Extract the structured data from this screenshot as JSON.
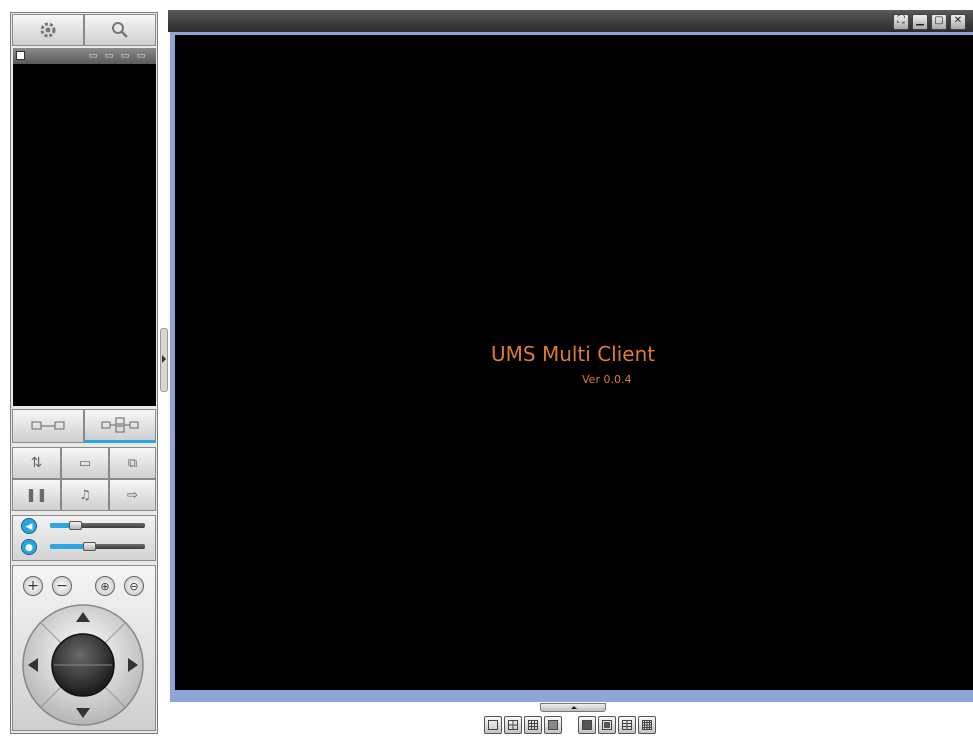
{
  "toolbar_top": {
    "settings_icon": "gear-icon",
    "search_icon": "magnifier-icon"
  },
  "device_panel": {
    "header_icons": [
      "add-device-icon",
      "edit-device-icon",
      "delete-device-icon",
      "refresh-device-icon"
    ]
  },
  "connection_tabs": [
    "single-connect-icon",
    "multi-connect-icon"
  ],
  "controls": {
    "row1": [
      "relay-icon",
      "edit-icon",
      "network-config-icon"
    ],
    "row2": [
      "pause-icon",
      "alarm-icon",
      "export-icon"
    ]
  },
  "sliders": {
    "volume": {
      "icon": "speaker-icon",
      "value": 0.27
    },
    "mic": {
      "icon": "microphone-icon",
      "value": 0.42
    }
  },
  "ptz": {
    "focus_plus": "+",
    "focus_minus": "−",
    "zoom_in_icon": "zoom-in-icon",
    "zoom_out_icon": "zoom-out-icon"
  },
  "window_controls": [
    "fullscreen-icon",
    "minimize-icon",
    "maximize-icon",
    "close-icon"
  ],
  "video": {
    "title": "UMS Multi Client",
    "version": "Ver 0.0.4"
  },
  "layout_buttons": [
    "1x1",
    "2x2",
    "3x3",
    "4x4",
    "1+5",
    "1+7",
    "3x4",
    "5x5"
  ],
  "colors": {
    "accent_blue": "#2aa6e0",
    "frame_blue": "#8fa5d8",
    "text_orange": "#e07a30"
  }
}
